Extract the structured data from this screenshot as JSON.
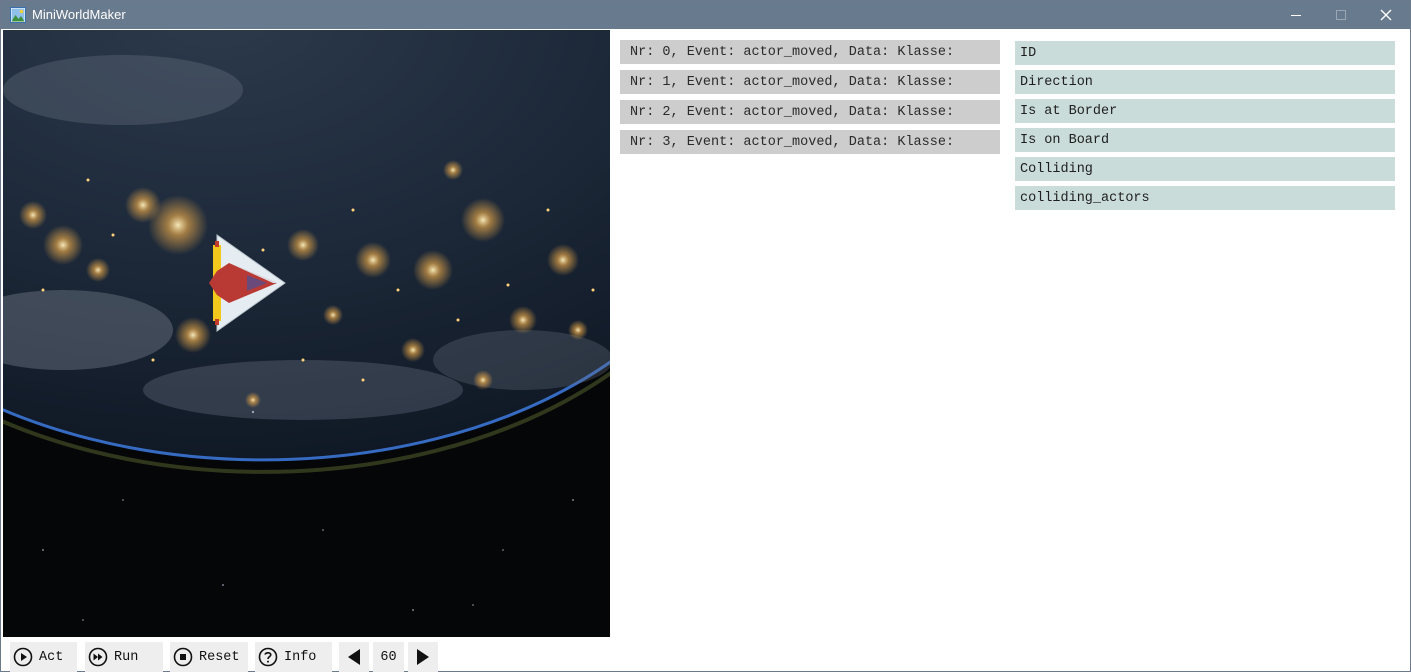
{
  "window": {
    "title": "MiniWorldMaker",
    "icon": "app-landscape-icon",
    "controls": [
      "minimize-icon",
      "maximize-icon",
      "close-icon"
    ]
  },
  "board": {
    "background": "earth-at-night-from-space",
    "actor": "spaceship-icon"
  },
  "events": [
    "Nr: 0, Event: actor_moved, Data: Klasse: ",
    "Nr: 1, Event: actor_moved, Data: Klasse: ",
    "Nr: 2, Event: actor_moved, Data: Klasse: ",
    "Nr: 3, Event: actor_moved, Data: Klasse: "
  ],
  "inspector": {
    "rows": [
      "ID",
      "Direction",
      "Is at Border",
      "Is on Board",
      "Colliding",
      "colliding_actors"
    ]
  },
  "toolbar": {
    "act_label": "Act",
    "run_label": "Run",
    "reset_label": "Reset",
    "info_label": "Info",
    "speed_value": "60"
  },
  "colors": {
    "titlebar": "#687a8e",
    "event_row": "#cdcdcd",
    "inspector_row": "#c9dcda",
    "toolbar_button": "#eeeeee"
  }
}
